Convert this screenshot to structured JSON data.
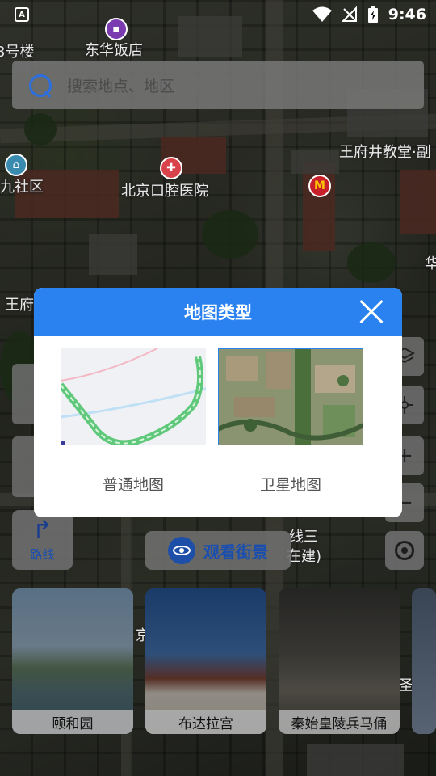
{
  "status_bar": {
    "time": "9:46"
  },
  "search": {
    "placeholder": "搜索地点、地区"
  },
  "map_labels": {
    "building_partial": "3号楼",
    "donghua_hotel": "东华饭店",
    "wangfujing_church": "王府井教堂·副",
    "jiu_community": "九社区",
    "peking_dental": "北京口腔医院",
    "wangfu": "王府",
    "hua": "华",
    "line3": "线三",
    "line3_b": "在建)",
    "jing": "京",
    "sheng": "圣",
    "jiao": "教"
  },
  "modal": {
    "title": "地图类型",
    "options": [
      {
        "label": "普通地图"
      },
      {
        "label": "卫星地图"
      }
    ]
  },
  "controls": {
    "route_label": "路线",
    "street_view_label": "观看街景",
    "layers_icon": "layers-icon",
    "measure_icon": "measure-icon",
    "zoom_in_symbol": "+",
    "zoom_out_symbol": "−"
  },
  "attractions": [
    {
      "name": "颐和园"
    },
    {
      "name": "布达拉宫"
    },
    {
      "name": "秦始皇陵兵马俑"
    }
  ],
  "colors": {
    "accent": "#2a82f0",
    "street_view_text": "#1a4fb0"
  }
}
